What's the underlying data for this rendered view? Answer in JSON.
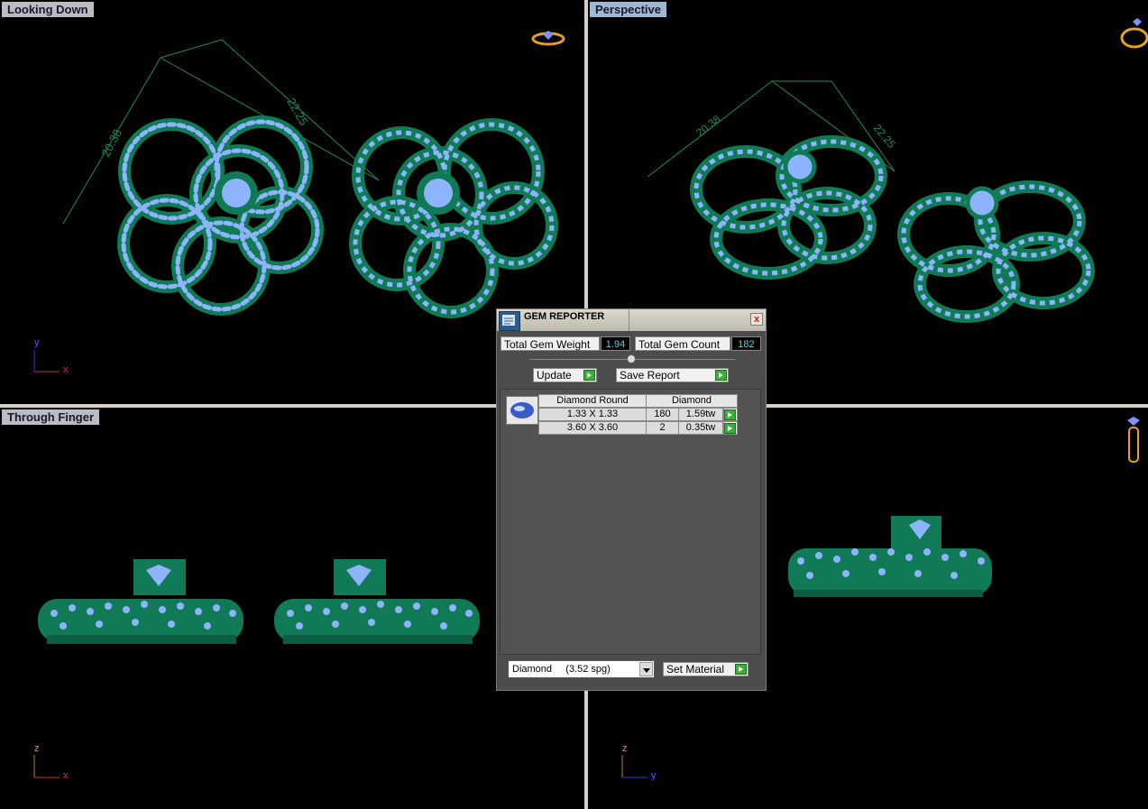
{
  "viewports": {
    "top_left": {
      "label": "Looking Down",
      "axis1": "y",
      "axis2": "x",
      "dim1": "20.38",
      "dim2": "22.25"
    },
    "top_right": {
      "label": "Perspective",
      "dim1": "20.38",
      "dim2": "22.25"
    },
    "bottom_left": {
      "label": "Through Finger",
      "axis1": "z",
      "axis2": "x"
    },
    "bottom_right": {
      "label": "",
      "axis1": "z",
      "axis2": "y"
    }
  },
  "gem_reporter": {
    "title": "GEM REPORTER",
    "close_label": "x",
    "total_weight_label": "Total Gem Weight",
    "total_weight_value": "1.94",
    "total_count_label": "Total Gem Count",
    "total_count_value": "182",
    "update_label": "Update",
    "save_report_label": "Save Report",
    "table": {
      "shape_header": "Diamond Round",
      "material_header": "Diamond",
      "rows": [
        {
          "size": "1.33 X 1.33",
          "count": "180",
          "weight": "1.59tw"
        },
        {
          "size": "3.60 X 3.60",
          "count": "2",
          "weight": "0.35tw"
        }
      ]
    },
    "material_select": "Diamond     (3.52 spg)",
    "set_material_label": "Set Material"
  },
  "colors": {
    "metal": "#0f7a55",
    "gem": "#8cb4ff",
    "dimension_line": "#1f8a5a",
    "viewport_bg": "#000000"
  }
}
